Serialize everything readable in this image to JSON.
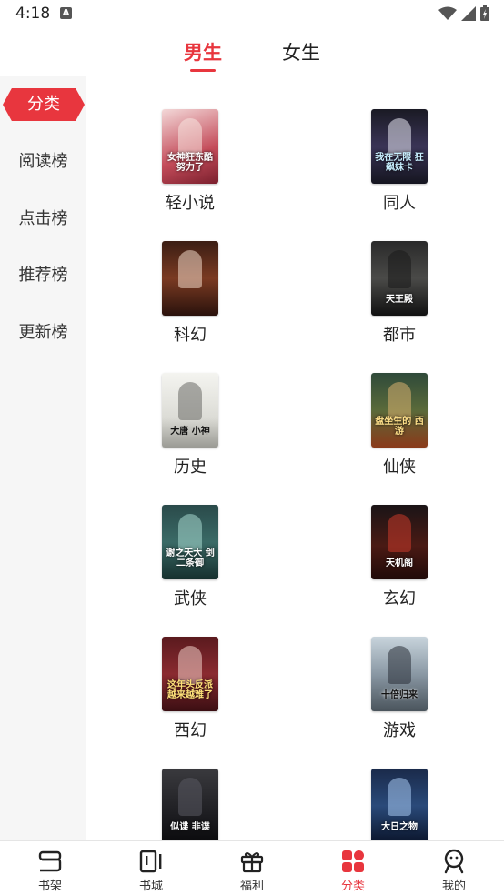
{
  "status_bar": {
    "time": "4:18",
    "notification_badge": "A"
  },
  "gender_tabs": [
    {
      "label": "男生",
      "active": true
    },
    {
      "label": "女生",
      "active": false
    }
  ],
  "sidebar": {
    "items": [
      {
        "label": "分类",
        "active": true
      },
      {
        "label": "阅读榜",
        "active": false
      },
      {
        "label": "点击榜",
        "active": false
      },
      {
        "label": "推荐榜",
        "active": false
      },
      {
        "label": "更新榜",
        "active": false
      }
    ]
  },
  "categories": [
    {
      "label": "轻小说",
      "cover_text": "女神狂东酷 努力了"
    },
    {
      "label": "同人",
      "cover_text": "我在无限 狂飙妹卡"
    },
    {
      "label": "科幻",
      "cover_text": ""
    },
    {
      "label": "都市",
      "cover_text": "天王殿"
    },
    {
      "label": "历史",
      "cover_text": "大唐 小神"
    },
    {
      "label": "仙侠",
      "cover_text": "盘坐生的 西游"
    },
    {
      "label": "武侠",
      "cover_text": "谢之天大 剑二条御"
    },
    {
      "label": "玄幻",
      "cover_text": "天机阁"
    },
    {
      "label": "西幻",
      "cover_text": "这年头反派 越来越难了"
    },
    {
      "label": "游戏",
      "cover_text": "十倍归来"
    },
    {
      "label": "",
      "cover_text": "似谍 非谍"
    },
    {
      "label": "",
      "cover_text": "大日之物"
    }
  ],
  "bottom_nav": [
    {
      "label": "书架",
      "icon": "bookshelf-icon",
      "active": false
    },
    {
      "label": "书城",
      "icon": "bookstore-icon",
      "active": false
    },
    {
      "label": "福利",
      "icon": "gift-icon",
      "active": false
    },
    {
      "label": "分类",
      "icon": "category-grid-icon",
      "active": true
    },
    {
      "label": "我的",
      "icon": "profile-icon",
      "active": false
    }
  ],
  "colors": {
    "accent": "#e8363e",
    "sidebar_bg": "#f6f6f6",
    "text": "#222222"
  }
}
